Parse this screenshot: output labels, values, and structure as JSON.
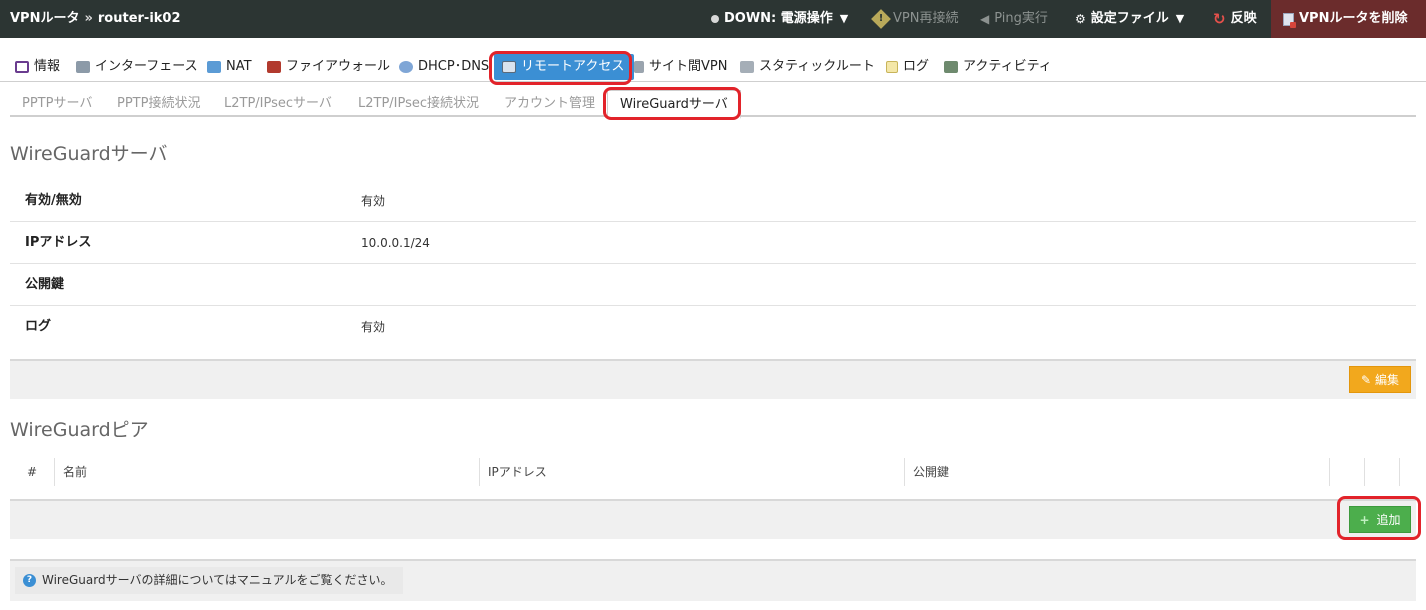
{
  "topbar": {
    "breadcrumb_root": "VPNルータ",
    "breadcrumb_sep": "»",
    "breadcrumb_current": "router-ik02",
    "status_label": "DOWN: 電源操作",
    "vpn_reconnect": "VPN再接続",
    "ping": "Ping実行",
    "config_file": "設定ファイル",
    "apply": "反映",
    "delete_router": "VPNルータを削除"
  },
  "nav": {
    "items": [
      {
        "label": "情報",
        "icon": "info-icon"
      },
      {
        "label": "インターフェース",
        "icon": "interface-icon"
      },
      {
        "label": "NAT",
        "icon": "nat-icon"
      },
      {
        "label": "ファイアウォール",
        "icon": "firewall-icon"
      },
      {
        "label": "DHCP･DNS",
        "icon": "dhcp-dns-icon"
      },
      {
        "label": "リモートアクセス",
        "icon": "remote-access-icon"
      },
      {
        "label": "サイト間VPN",
        "icon": "site-vpn-icon"
      },
      {
        "label": "スタティックルート",
        "icon": "static-route-icon"
      },
      {
        "label": "ログ",
        "icon": "log-icon"
      },
      {
        "label": "アクティビティ",
        "icon": "activity-icon"
      }
    ]
  },
  "subnav": {
    "items": [
      {
        "label": "PPTPサーバ"
      },
      {
        "label": "PPTP接続状況"
      },
      {
        "label": "L2TP/IPsecサーバ"
      },
      {
        "label": "L2TP/IPsec接続状況"
      },
      {
        "label": "アカウント管理"
      },
      {
        "label": "WireGuardサーバ"
      }
    ]
  },
  "server": {
    "title": "WireGuardサーバ",
    "rows": [
      {
        "key": "有効/無効",
        "value": "有効"
      },
      {
        "key": "IPアドレス",
        "value": "10.0.0.1/24"
      },
      {
        "key": "公開鍵",
        "value": ""
      },
      {
        "key": "ログ",
        "value": "有効"
      }
    ],
    "edit_label": "編集"
  },
  "peers": {
    "title": "WireGuardピア",
    "columns": [
      "#",
      "名前",
      "IPアドレス",
      "公開鍵"
    ],
    "add_label": "追加"
  },
  "info_text": "WireGuardサーバの詳細についてはマニュアルをご覧ください。",
  "colors": {
    "topbar_bg": "#2c3533",
    "active_tab": "#3b8fd4",
    "highlight": "#e2232a",
    "edit_button": "#f2a81d",
    "add_button": "#4cae4c",
    "danger_bg": "#6b2c2c"
  }
}
